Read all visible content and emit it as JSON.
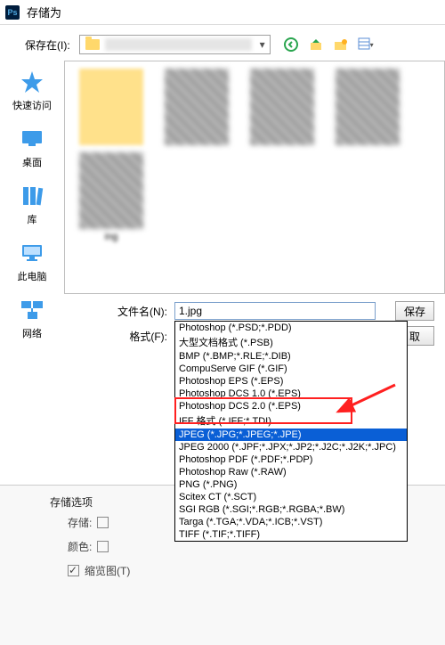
{
  "window": {
    "title": "存储为"
  },
  "toolbar": {
    "saveInLabel": "保存在(I):"
  },
  "sidebar": {
    "items": [
      {
        "label": "快速访问"
      },
      {
        "label": "桌面"
      },
      {
        "label": "库"
      },
      {
        "label": "此电脑"
      },
      {
        "label": "网络"
      }
    ]
  },
  "thumbs": {
    "lastLabel": "ing"
  },
  "fields": {
    "filenameLabel": "文件名(N):",
    "filenameValue": "1.jpg",
    "formatLabel": "格式(F):",
    "formatValue": "JPEG (*.JPG;*.JPEG;*.JPE)"
  },
  "buttons": {
    "save": "保存",
    "cancel": "取"
  },
  "dropdown": {
    "items": [
      "Photoshop (*.PSD;*.PDD)",
      "大型文档格式 (*.PSB)",
      "BMP (*.BMP;*.RLE;*.DIB)",
      "CompuServe GIF (*.GIF)",
      "Photoshop EPS (*.EPS)",
      "Photoshop DCS 1.0 (*.EPS)",
      "Photoshop DCS 2.0 (*.EPS)",
      "IFF 格式 (*.IFF;*.TDI)",
      "JPEG (*.JPG;*.JPEG;*.JPE)",
      "JPEG 2000 (*.JPF;*.JPX;*.JP2;*.J2C;*.J2K;*.JPC)",
      "Photoshop PDF (*.PDF;*.PDP)",
      "Photoshop Raw (*.RAW)",
      "PNG (*.PNG)",
      "Scitex CT (*.SCT)",
      "SGI RGB (*.SGI;*.RGB;*.RGBA;*.BW)",
      "Targa (*.TGA;*.VDA;*.ICB;*.VST)",
      "TIFF (*.TIF;*.TIFF)"
    ],
    "selectedIndex": 8
  },
  "options": {
    "title": "存储选项",
    "storeLabel": "存储:",
    "colorLabel": "颜色:",
    "thumbLabel": "缩览图(T)"
  }
}
